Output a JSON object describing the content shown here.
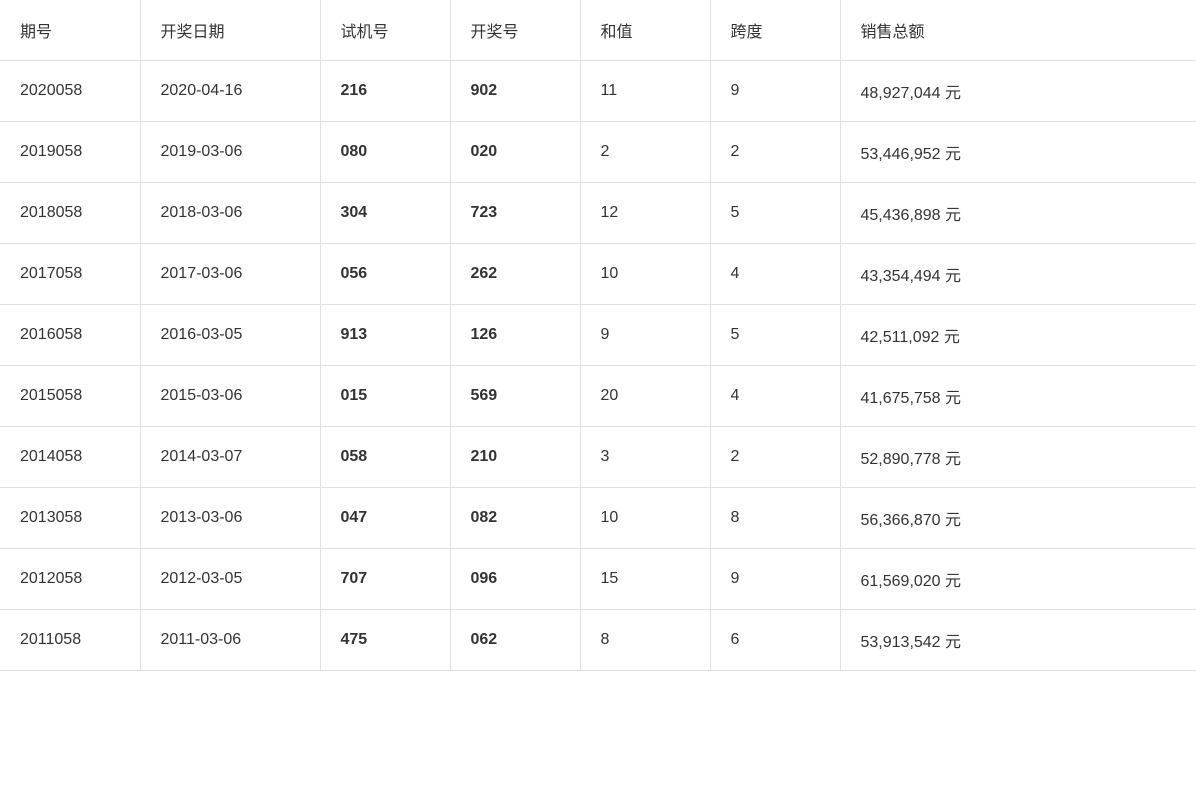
{
  "table": {
    "columns": [
      {
        "key": "period",
        "label": "期号"
      },
      {
        "key": "date",
        "label": "开奖日期"
      },
      {
        "key": "trial",
        "label": "试机号"
      },
      {
        "key": "draw",
        "label": "开奖号"
      },
      {
        "key": "sum",
        "label": "和值"
      },
      {
        "key": "span",
        "label": "跨度"
      },
      {
        "key": "sales",
        "label": "销售总额"
      }
    ],
    "rows": [
      {
        "period": "2020058",
        "date": "2020-04-16",
        "trial": "216",
        "draw": "902",
        "sum": "11",
        "span": "9",
        "sales": "48,927,044 元"
      },
      {
        "period": "2019058",
        "date": "2019-03-06",
        "trial": "080",
        "draw": "020",
        "sum": "2",
        "span": "2",
        "sales": "53,446,952 元"
      },
      {
        "period": "2018058",
        "date": "2018-03-06",
        "trial": "304",
        "draw": "723",
        "sum": "12",
        "span": "5",
        "sales": "45,436,898 元"
      },
      {
        "period": "2017058",
        "date": "2017-03-06",
        "trial": "056",
        "draw": "262",
        "sum": "10",
        "span": "4",
        "sales": "43,354,494 元"
      },
      {
        "period": "2016058",
        "date": "2016-03-05",
        "trial": "913",
        "draw": "126",
        "sum": "9",
        "span": "5",
        "sales": "42,511,092 元"
      },
      {
        "period": "2015058",
        "date": "2015-03-06",
        "trial": "015",
        "draw": "569",
        "sum": "20",
        "span": "4",
        "sales": "41,675,758 元"
      },
      {
        "period": "2014058",
        "date": "2014-03-07",
        "trial": "058",
        "draw": "210",
        "sum": "3",
        "span": "2",
        "sales": "52,890,778 元"
      },
      {
        "period": "2013058",
        "date": "2013-03-06",
        "trial": "047",
        "draw": "082",
        "sum": "10",
        "span": "8",
        "sales": "56,366,870 元"
      },
      {
        "period": "2012058",
        "date": "2012-03-05",
        "trial": "707",
        "draw": "096",
        "sum": "15",
        "span": "9",
        "sales": "61,569,020 元"
      },
      {
        "period": "2011058",
        "date": "2011-03-06",
        "trial": "475",
        "draw": "062",
        "sum": "8",
        "span": "6",
        "sales": "53,913,542 元"
      }
    ]
  }
}
